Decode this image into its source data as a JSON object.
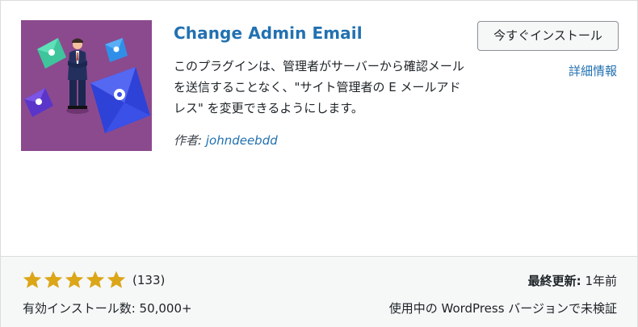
{
  "plugin": {
    "title": "Change Admin Email",
    "description": "このプラグインは、管理者がサーバーから確認メールを送信することなく、\"サイト管理者の E メールアドレス\" を変更できるようにします。",
    "author_label": "作者:",
    "author_name": "johndeebdd"
  },
  "actions": {
    "install_label": "今すぐインストール",
    "details_label": "詳細情報"
  },
  "stats": {
    "rating_stars": 5,
    "rating_max": 5,
    "rating_count": "(133)",
    "active_installs": "有効インストール数: 50,000+",
    "last_updated_label": "最終更新:",
    "last_updated_value": "1年前",
    "compatibility": "使用中の WordPress バージョンで未検証"
  },
  "colors": {
    "accent": "#2271b1",
    "star": "#dba617",
    "thumb_bg": "#8b4a8e"
  }
}
